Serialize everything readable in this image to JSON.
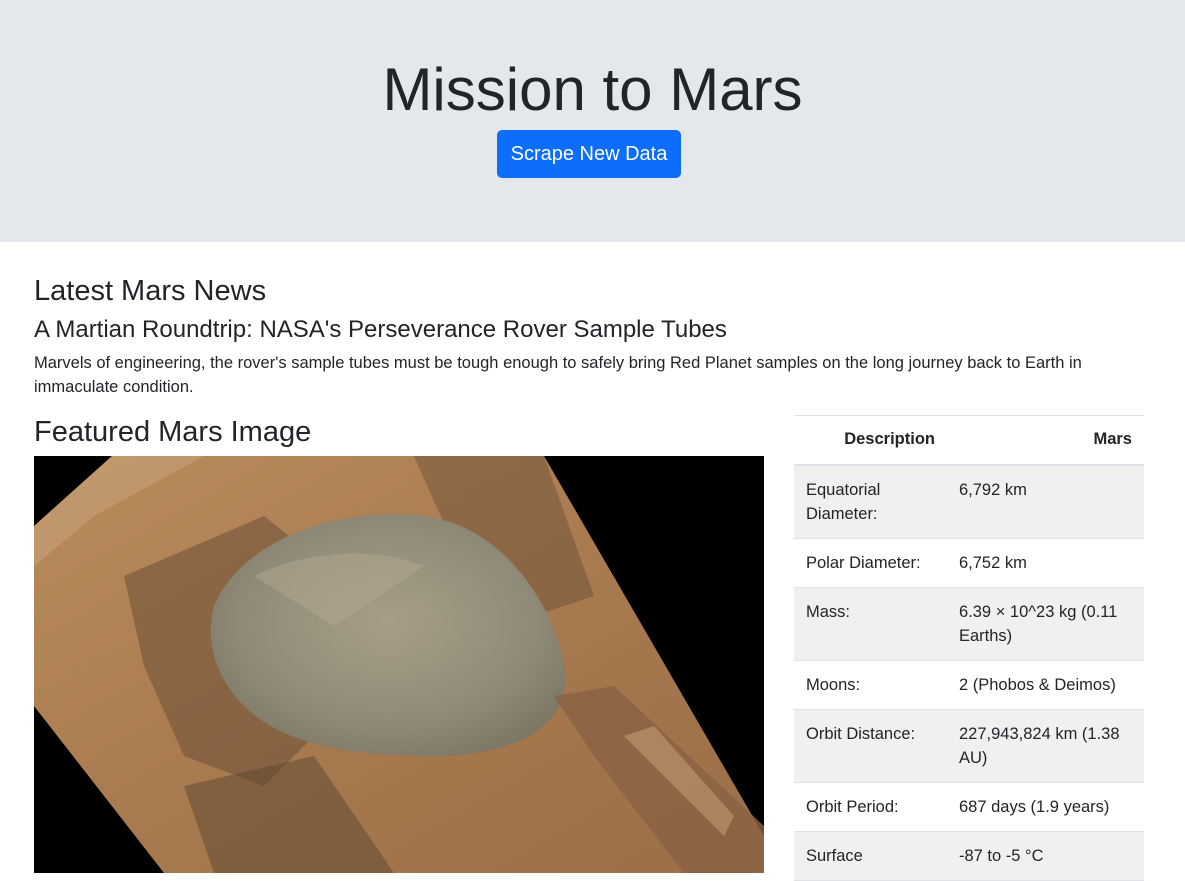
{
  "header": {
    "title": "Mission to Mars",
    "scrape_button_label": "Scrape New Data"
  },
  "news": {
    "heading": "Latest Mars News",
    "title": "A Martian Roundtrip: NASA's Perseverance Rover Sample Tubes",
    "paragraph": "Marvels of engineering, the rover's sample tubes must be tough enough to safely bring Red Planet samples on the long journey back to Earth in immaculate condition."
  },
  "featured": {
    "heading": "Featured Mars Image"
  },
  "facts": {
    "columns": [
      "Description",
      "Mars"
    ],
    "rows": [
      {
        "label": "Equatorial Diameter:",
        "value": "6,792 km"
      },
      {
        "label": "Polar Diameter:",
        "value": "6,752 km"
      },
      {
        "label": "Mass:",
        "value": "6.39 × 10^23 kg (0.11 Earths)"
      },
      {
        "label": "Moons:",
        "value": "2 (Phobos & Deimos)"
      },
      {
        "label": "Orbit Distance:",
        "value": "227,943,824 km (1.38 AU)"
      },
      {
        "label": "Orbit Period:",
        "value": "687 days (1.9 years)"
      },
      {
        "label": "Surface",
        "value": "-87 to -5 °C"
      }
    ]
  },
  "colors": {
    "jumbotron_bg": "#e4e7ec",
    "button_bg": "#0d6efd",
    "striped_row_bg": "#f0f0f0"
  }
}
